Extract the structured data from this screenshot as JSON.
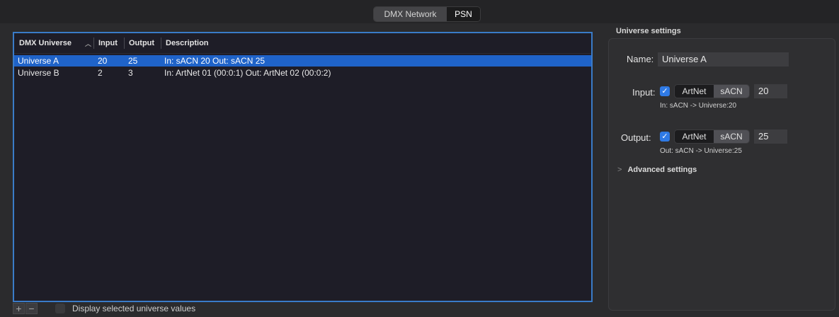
{
  "tabs": [
    {
      "label": "DMX Network"
    },
    {
      "label": "PSN"
    }
  ],
  "table": {
    "columns": [
      "DMX Universe",
      "Input",
      "Output",
      "Description"
    ],
    "rows": [
      {
        "name": "Universe A",
        "input": "20",
        "output": "25",
        "description": "In: sACN 20 Out: sACN 25"
      },
      {
        "name": "Universe B",
        "input": "2",
        "output": "3",
        "description": "In: ArtNet 01 (00:0:1) Out: ArtNet 02 (00:0:2)"
      }
    ]
  },
  "bottom": {
    "add": "+",
    "remove": "−",
    "display_label": "Display selected universe values"
  },
  "settings": {
    "title": "Universe settings",
    "name_label": "Name:",
    "name_value": "Universe A",
    "input_label": "Input:",
    "input_options": [
      "ArtNet",
      "sACN"
    ],
    "input_value": "20",
    "input_info": "In: sACN -> Universe:20",
    "output_label": "Output:",
    "output_options": [
      "ArtNet",
      "sACN"
    ],
    "output_value": "25",
    "output_info": "Out: sACN -> Universe:25",
    "advanced_label": "Advanced settings",
    "check_mark": "✓",
    "chevron": ">"
  },
  "colors": {
    "accent": "#2f7ae5",
    "selection": "#1f63c9"
  }
}
